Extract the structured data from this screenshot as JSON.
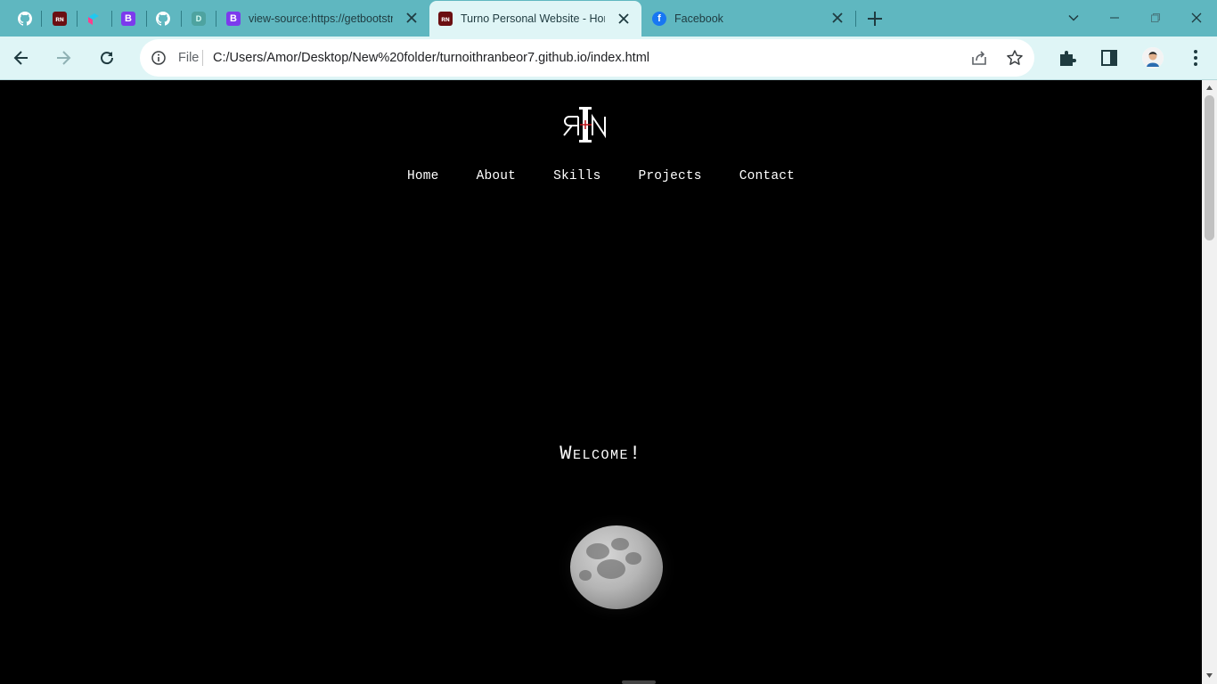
{
  "browser": {
    "pinned_tabs": [
      {
        "icon": "github-icon"
      },
      {
        "icon": "rn-logo-favicon-icon"
      },
      {
        "icon": "figma-like-favicon-icon"
      },
      {
        "icon": "bootstrap-icon",
        "glyph": "B"
      },
      {
        "icon": "github-icon"
      },
      {
        "icon": "d-favicon-icon",
        "glyph": "D"
      }
    ],
    "tabs": [
      {
        "title": "view-source:https://getbootstr",
        "icon": "bootstrap-icon",
        "glyph": "B",
        "active": false
      },
      {
        "title": "Turno Personal Website - Hom",
        "icon": "rn-logo-favicon-icon",
        "active": true
      },
      {
        "title": "Facebook",
        "icon": "facebook-icon",
        "glyph": "f",
        "active": false
      }
    ],
    "omnibox": {
      "scheme_label": "File",
      "url": "C:/Users/Amor/Desktop/New%20folder/turnoithranbeor7.github.io/index.html"
    },
    "colors": {
      "tabstrip": "#5fb7c0",
      "toolbar": "#dff5f6"
    }
  },
  "page": {
    "nav": [
      "Home",
      "About",
      "Skills",
      "Projects",
      "Contact"
    ],
    "welcome": "Welcome!",
    "background": "#000000"
  }
}
